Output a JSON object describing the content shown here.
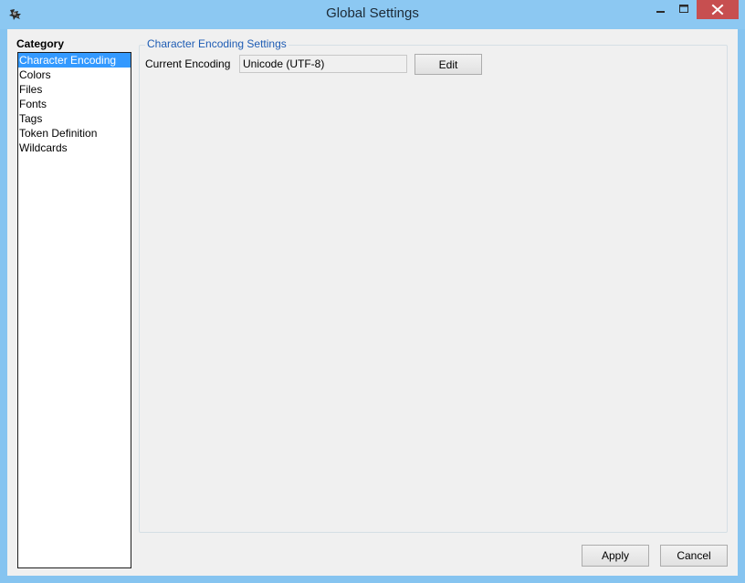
{
  "window": {
    "title": "Global Settings",
    "icons": {
      "app": "app-logo-icon",
      "minimize": "minimize-icon",
      "maximize": "maximize-icon",
      "close": "close-icon"
    }
  },
  "sidebar": {
    "heading": "Category",
    "selected_index": 0,
    "items": [
      {
        "label": "Character Encoding"
      },
      {
        "label": "Colors"
      },
      {
        "label": "Files"
      },
      {
        "label": "Fonts"
      },
      {
        "label": "Tags"
      },
      {
        "label": "Token Definition"
      },
      {
        "label": "Wildcards"
      }
    ]
  },
  "encoding_group": {
    "legend": "Character Encoding Settings",
    "current_label": "Current Encoding",
    "current_value": "Unicode (UTF-8)",
    "edit_label": "Edit"
  },
  "footer": {
    "apply_label": "Apply",
    "cancel_label": "Cancel"
  },
  "colors": {
    "title_bar": "#8cc8f2",
    "close_button": "#c74f50",
    "selection": "#3399ff",
    "legend_text": "#1e5cb4"
  }
}
